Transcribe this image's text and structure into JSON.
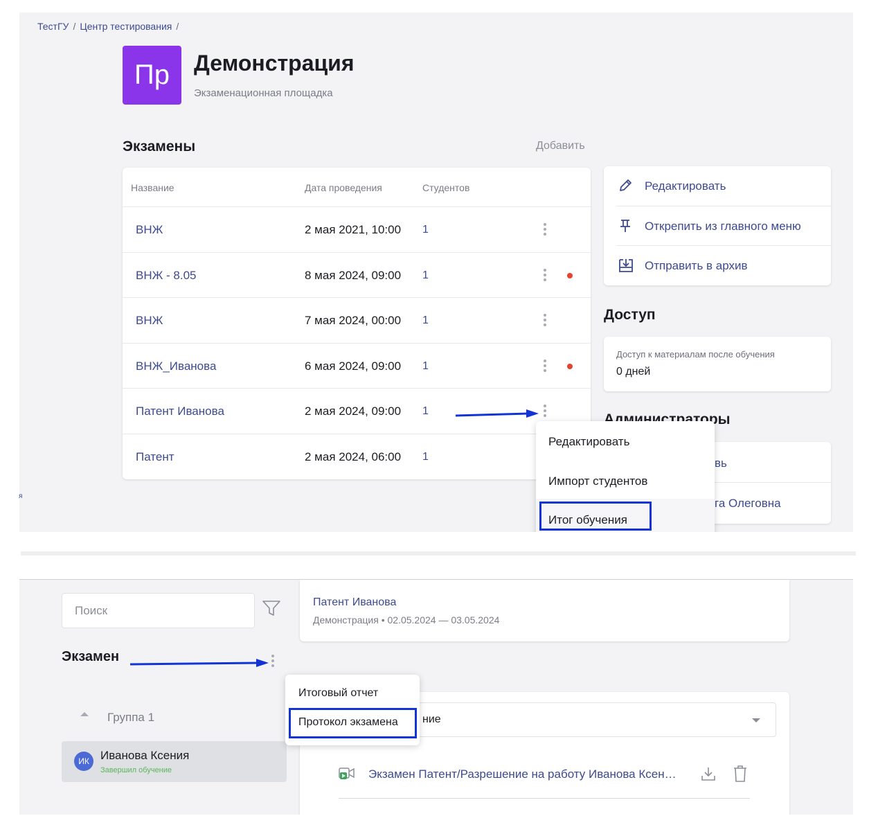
{
  "breadcrumb": {
    "items": [
      "ТестГУ",
      "Центр тестирования"
    ],
    "trailing_sep": "/"
  },
  "header": {
    "logo_text": "Пр",
    "title": "Демонстрация",
    "subtitle": "Экзаменационная площадка"
  },
  "exams": {
    "title": "Экзамены",
    "add_label": "Добавить",
    "columns": [
      "Название",
      "Дата проведения",
      "Студентов"
    ],
    "rows": [
      {
        "name": "ВНЖ",
        "date": "2 мая 2021, 10:00",
        "count": "1",
        "alert": false
      },
      {
        "name": "ВНЖ - 8.05",
        "date": "8 мая 2024, 09:00",
        "count": "1",
        "alert": true
      },
      {
        "name": "ВНЖ",
        "date": "7 мая 2024, 00:00",
        "count": "1",
        "alert": false
      },
      {
        "name": "ВНЖ_Иванова",
        "date": "6 мая 2024, 09:00",
        "count": "1",
        "alert": true
      },
      {
        "name": "Патент Иванова",
        "date": "2 мая 2024, 09:00",
        "count": "1",
        "alert": false
      },
      {
        "name": "Патент",
        "date": "2 мая 2024, 06:00",
        "count": "1",
        "alert": false
      }
    ]
  },
  "actions": {
    "edit": "Редактировать",
    "unpin": "Открепить из главного меню",
    "archive": "Отправить в архив"
  },
  "access": {
    "title": "Доступ",
    "label": "Доступ к материалам после обучения",
    "value": "0 дней"
  },
  "admins": {
    "title": "Администраторы",
    "row1_partial": "вь",
    "row2_partial": "га Олеговна"
  },
  "row_menu": {
    "items": [
      "Редактировать",
      "Импорт студентов",
      "Итог обучения"
    ],
    "highlighted": "Итог обучения"
  },
  "stray_char": "я",
  "bottom": {
    "search_placeholder": "Поиск",
    "exam_title": "Патент Иванова",
    "exam_meta": "Демонстрация • 02.05.2024 — 03.05.2024",
    "section": "Экзамен",
    "group": "Группа 1",
    "student_initials": "ИК",
    "student_name": "Иванова Ксения",
    "student_status": "Завершил обучение",
    "menu_items": [
      "Итоговый отчет",
      "Протокол экзамена"
    ],
    "highlighted": "Протокол экзамена",
    "select_partial": "ние",
    "file_name": "Экзамен Патент/Разрешение на работу Иванова Ксен…"
  },
  "colors": {
    "accent": "#3d4a8f",
    "logo": "#8a35ea",
    "alert": "#e5432f",
    "highlight": "#1234d6",
    "status": "#5bb55b"
  }
}
